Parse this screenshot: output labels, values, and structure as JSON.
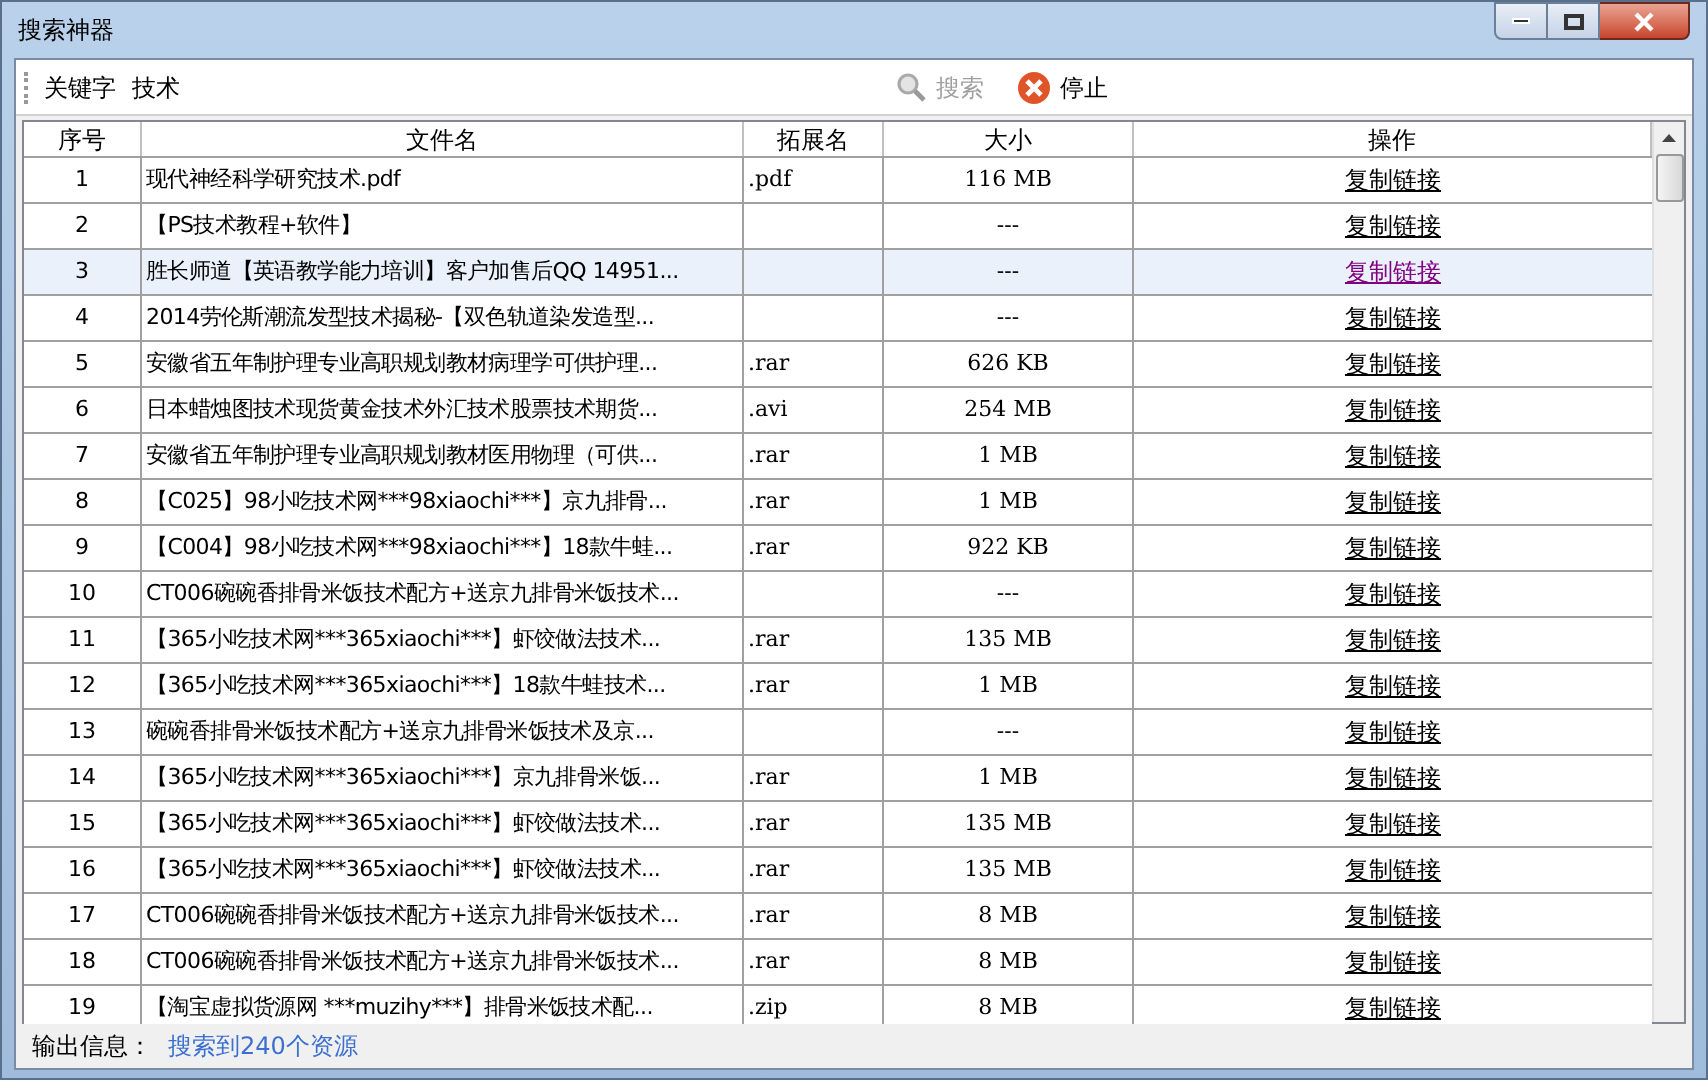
{
  "window": {
    "title": "搜索神器"
  },
  "toolbar": {
    "keyword_label": "关键字",
    "keyword_value": "技术",
    "search_button": {
      "label": "搜索",
      "disabled": true
    },
    "stop_button": {
      "label": "停止"
    }
  },
  "table": {
    "columns": [
      "序号",
      "文件名",
      "拓展名",
      "大小",
      "操作"
    ],
    "rows": [
      {
        "index": "1",
        "name": "现代神经科学研究技术.pdf",
        "ext": ".pdf",
        "size": "116 MB",
        "action": "复制链接",
        "selected": false,
        "visited": false
      },
      {
        "index": "2",
        "name": "【PS技术教程+软件】",
        "ext": "",
        "size": "---",
        "action": "复制链接",
        "selected": false,
        "visited": false
      },
      {
        "index": "3",
        "name": "胜长师道【英语教学能力培训】客户加售后QQ 14951...",
        "ext": "",
        "size": "---",
        "action": "复制链接",
        "selected": true,
        "visited": true
      },
      {
        "index": "4",
        "name": "2014劳伦斯潮流发型技术揭秘-【双色轨道染发造型...",
        "ext": "",
        "size": "---",
        "action": "复制链接",
        "selected": false,
        "visited": false
      },
      {
        "index": "5",
        "name": "安徽省五年制护理专业高职规划教材病理学可供护理...",
        "ext": ".rar",
        "size": "626 KB",
        "action": "复制链接",
        "selected": false,
        "visited": false
      },
      {
        "index": "6",
        "name": "日本蜡烛图技术现货黄金技术外汇技术股票技术期货...",
        "ext": ".avi",
        "size": "254 MB",
        "action": "复制链接",
        "selected": false,
        "visited": false
      },
      {
        "index": "7",
        "name": "安徽省五年制护理专业高职规划教材医用物理（可供...",
        "ext": ".rar",
        "size": "1 MB",
        "action": "复制链接",
        "selected": false,
        "visited": false
      },
      {
        "index": "8",
        "name": "【C025】98小吃技术网***98xiaochi***】京九排骨...",
        "ext": ".rar",
        "size": "1 MB",
        "action": "复制链接",
        "selected": false,
        "visited": false
      },
      {
        "index": "9",
        "name": "【C004】98小吃技术网***98xiaochi***】18款牛蛙...",
        "ext": ".rar",
        "size": "922 KB",
        "action": "复制链接",
        "selected": false,
        "visited": false
      },
      {
        "index": "10",
        "name": "CT006碗碗香排骨米饭技术配方+送京九排骨米饭技术...",
        "ext": "",
        "size": "---",
        "action": "复制链接",
        "selected": false,
        "visited": false
      },
      {
        "index": "11",
        "name": "【365小吃技术网***365xiaochi***】虾饺做法技术...",
        "ext": ".rar",
        "size": "135 MB",
        "action": "复制链接",
        "selected": false,
        "visited": false
      },
      {
        "index": "12",
        "name": "【365小吃技术网***365xiaochi***】18款牛蛙技术...",
        "ext": ".rar",
        "size": "1 MB",
        "action": "复制链接",
        "selected": false,
        "visited": false
      },
      {
        "index": "13",
        "name": "碗碗香排骨米饭技术配方+送京九排骨米饭技术及京...",
        "ext": "",
        "size": "---",
        "action": "复制链接",
        "selected": false,
        "visited": false
      },
      {
        "index": "14",
        "name": "【365小吃技术网***365xiaochi***】京九排骨米饭...",
        "ext": ".rar",
        "size": "1 MB",
        "action": "复制链接",
        "selected": false,
        "visited": false
      },
      {
        "index": "15",
        "name": "【365小吃技术网***365xiaochi***】虾饺做法技术...",
        "ext": ".rar",
        "size": "135 MB",
        "action": "复制链接",
        "selected": false,
        "visited": false
      },
      {
        "index": "16",
        "name": "【365小吃技术网***365xiaochi***】虾饺做法技术...",
        "ext": ".rar",
        "size": "135 MB",
        "action": "复制链接",
        "selected": false,
        "visited": false
      },
      {
        "index": "17",
        "name": "CT006碗碗香排骨米饭技术配方+送京九排骨米饭技术...",
        "ext": ".rar",
        "size": "8 MB",
        "action": "复制链接",
        "selected": false,
        "visited": false
      },
      {
        "index": "18",
        "name": "CT006碗碗香排骨米饭技术配方+送京九排骨米饭技术...",
        "ext": ".rar",
        "size": "8 MB",
        "action": "复制链接",
        "selected": false,
        "visited": false
      },
      {
        "index": "19",
        "name": "【淘宝虚拟货源网 ***muzihy***】排骨米饭技术配...",
        "ext": ".zip",
        "size": "8 MB",
        "action": "复制链接",
        "selected": false,
        "visited": false
      }
    ]
  },
  "status_bar": {
    "label": "输出信息：",
    "message": "搜索到240个资源"
  }
}
